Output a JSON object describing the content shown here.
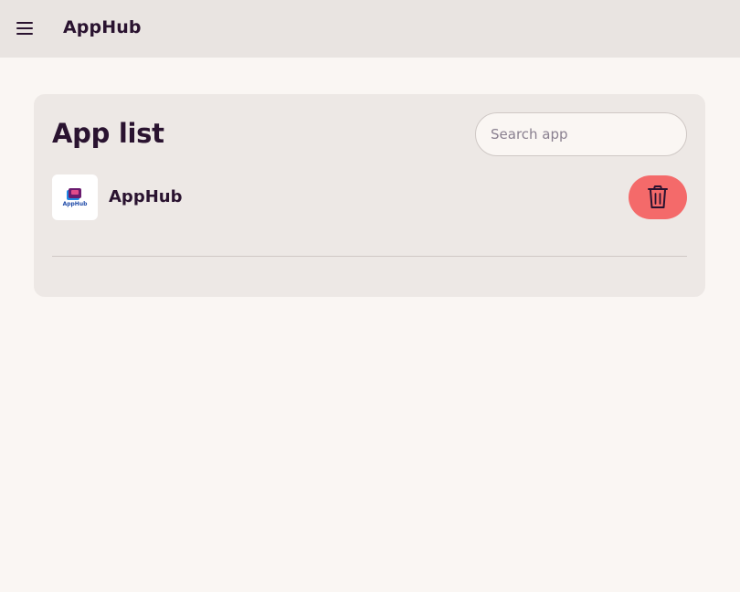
{
  "header": {
    "menu_icon": "hamburger-menu-icon",
    "title": "AppHub"
  },
  "main": {
    "title": "App list",
    "search": {
      "placeholder": "Search app",
      "value": ""
    },
    "apps": [
      {
        "name": "AppHub",
        "icon": "apphub-logo",
        "icon_text": "AppHub",
        "delete_icon": "trash-icon"
      }
    ]
  },
  "colors": {
    "header_bg": "#e9e4e1",
    "page_bg": "#faf6f3",
    "card_bg": "#ede8e5",
    "text": "#2a1330",
    "delete_button": "#f46a6a"
  }
}
